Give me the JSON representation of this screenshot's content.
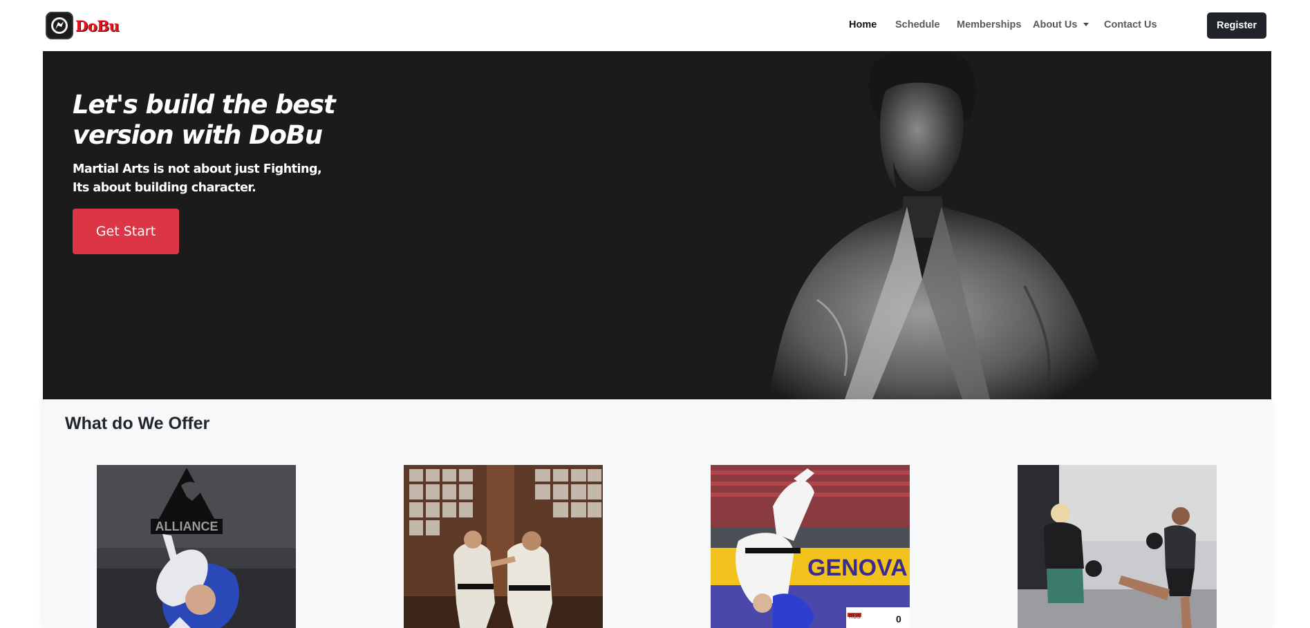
{
  "navbar": {
    "brand_name": "DoBu",
    "links": [
      {
        "label": "Home",
        "active": true
      },
      {
        "label": "Schedule",
        "active": false
      },
      {
        "label": "Memberships",
        "active": false
      },
      {
        "label": "About Us",
        "active": false,
        "dropdown": true
      },
      {
        "label": "Contact Us",
        "active": false
      }
    ],
    "register_label": "Register"
  },
  "hero": {
    "title": "Let's build the best version with DoBu",
    "subtitle_line1": "Martial Arts is not about just Fighting,",
    "subtitle_line2": "Its about building character.",
    "cta_label": "Get Start",
    "cta_color": "#dc3545",
    "background_color": "#1b1b1d"
  },
  "offer": {
    "title": "What do We Offer",
    "cards": [
      {
        "image": "bjj-alliance-photo",
        "banner_text": "ALLIANCE"
      },
      {
        "image": "karate-dojo-photo"
      },
      {
        "image": "judo-competition-photo",
        "banner_text": "GENOVA",
        "scoreboard_country": "RUS",
        "scoreboard_score": "0"
      },
      {
        "image": "muay-thai-training-photo"
      }
    ]
  }
}
